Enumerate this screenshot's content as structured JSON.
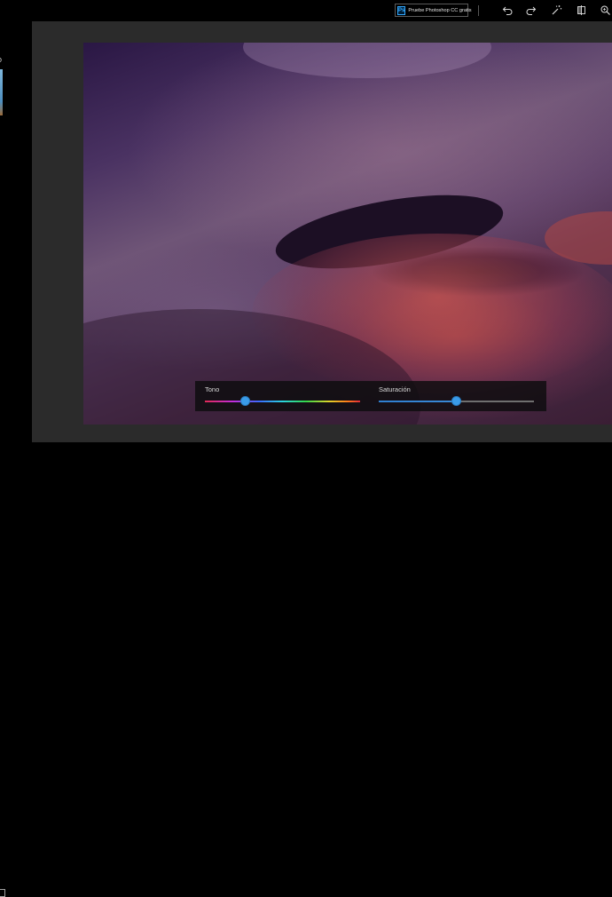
{
  "toolbar": {
    "try_photoshop_label": "Pruebe Photoshop CC gratis",
    "photoshop_logo_text": "Ps",
    "icons": [
      "undo-icon",
      "redo-icon",
      "magic-wand-icon",
      "compare-icon",
      "zoom-icon"
    ]
  },
  "left_panel": {
    "partial_glyph": "o"
  },
  "photo": {
    "description_icon": "photo-landscape"
  },
  "adjustments": {
    "hue": {
      "label": "Tono",
      "value": 0.26
    },
    "saturation": {
      "label": "Saturación",
      "value": 0.5
    }
  },
  "colors": {
    "accent": "#3a9be8",
    "canvas_bg": "#2b2b2b",
    "chrome_bg": "#000000"
  }
}
